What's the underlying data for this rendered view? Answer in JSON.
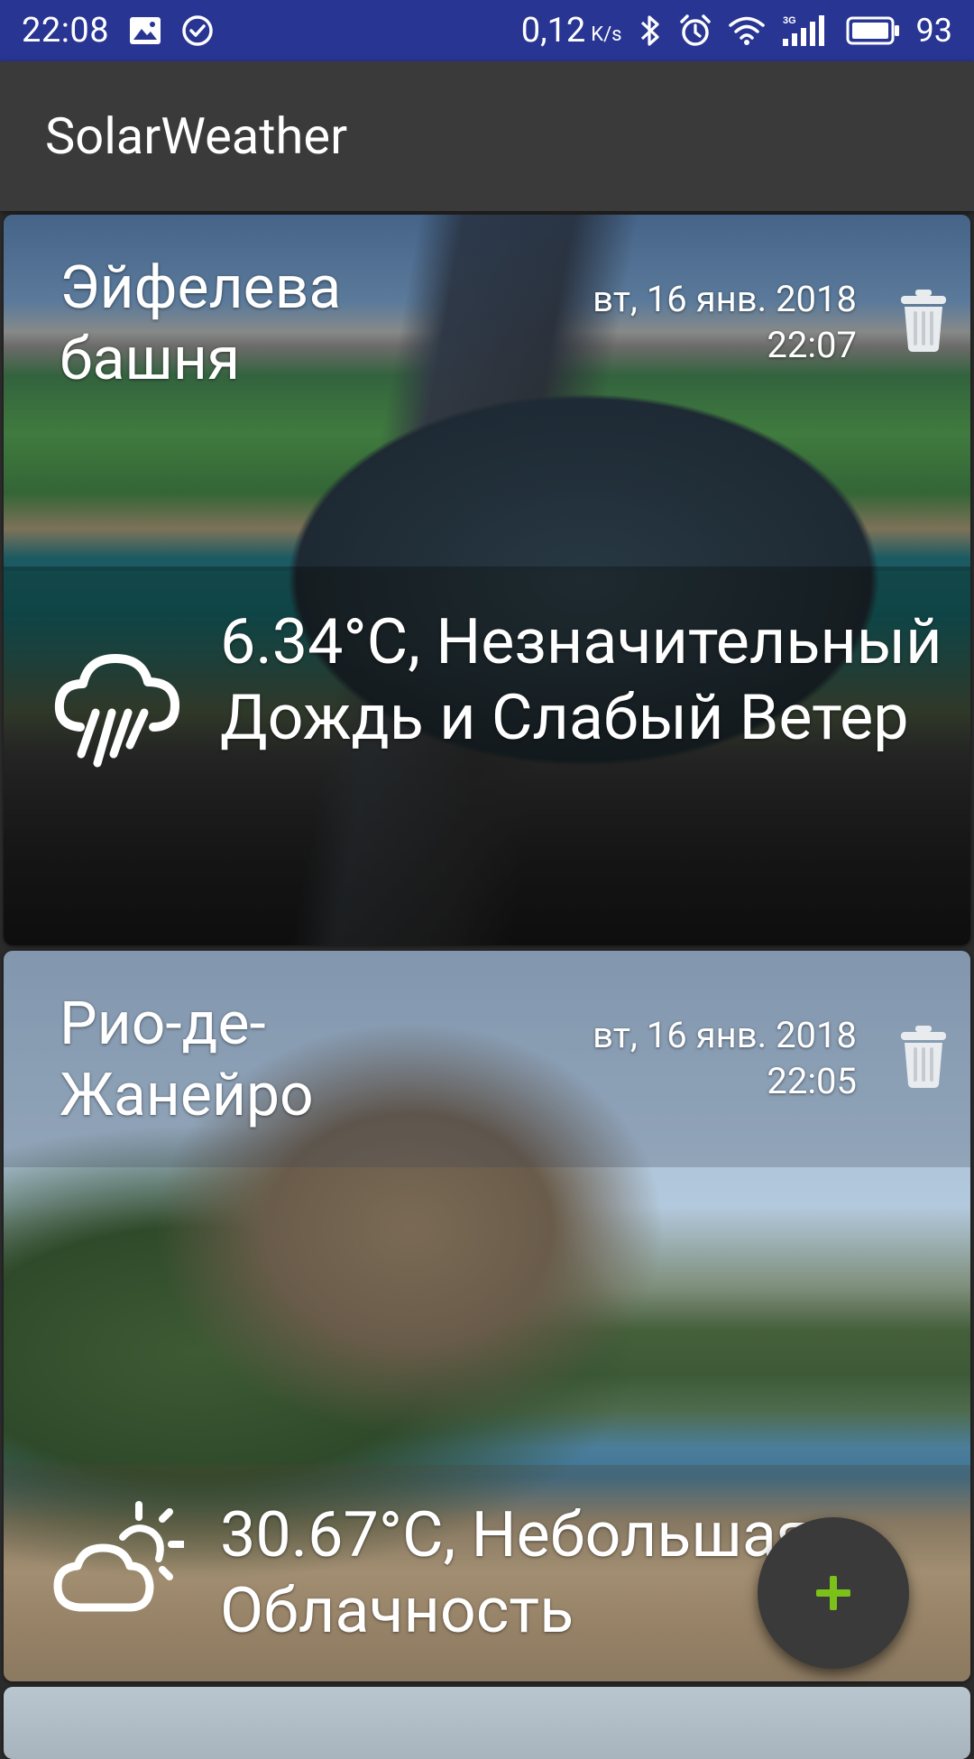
{
  "status_bar": {
    "time": "22:08",
    "speed_value": "0,12",
    "speed_unit": "K/s",
    "battery": "93",
    "network": "3G",
    "icons": [
      "image-icon",
      "check-circle-icon",
      "bluetooth-icon",
      "alarm-icon",
      "wifi-icon",
      "signal-icon",
      "battery-icon"
    ]
  },
  "app_bar": {
    "title": "SolarWeather"
  },
  "cards": [
    {
      "city_line1": "Эйфелева",
      "city_line2": "башня",
      "date": "вт, 16 янв. 2018",
      "time": "22:07",
      "weather": "6.34°C, Незначительный Дождь и Слабый Ветер",
      "weather_icon": "rain-cloud-icon"
    },
    {
      "city_line1": "Рио-де-",
      "city_line2": "Жанейро",
      "date": "вт, 16 янв. 2018",
      "time": "22:05",
      "weather_line1": "30.67°C, Небольшая",
      "weather_line2": "Облачность",
      "weather_icon": "partly-cloudy-icon"
    }
  ],
  "fab": {
    "icon": "plus-icon",
    "color": "#7cc11a"
  },
  "colors": {
    "status_bar": "#283593",
    "app_bar": "#3a3a3a",
    "background": "#2b2b2b",
    "fab": "#3a3a3a",
    "fab_plus": "#7cc11a"
  }
}
